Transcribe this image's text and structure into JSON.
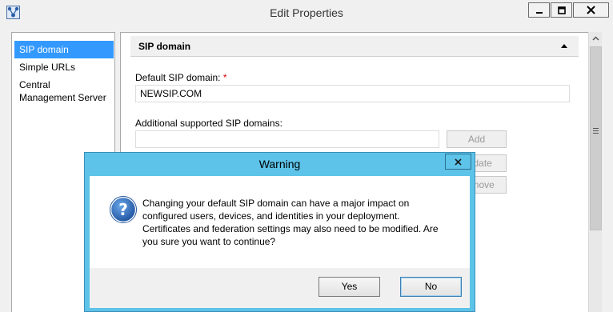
{
  "window": {
    "title": "Edit Properties",
    "icon": "topology-app-icon",
    "controls": {
      "minimize": "minimize-icon",
      "maximize": "maximize-icon",
      "close": "close-icon"
    }
  },
  "nav": {
    "items": [
      {
        "label": "SIP domain",
        "selected": true
      },
      {
        "label": "Simple URLs",
        "selected": false
      },
      {
        "label": "Central Management Server",
        "selected": false
      }
    ]
  },
  "section": {
    "title": "SIP domain",
    "default_label": "Default SIP domain:",
    "required_marker": "*",
    "default_value": "NEWSIP.COM",
    "additional_label": "Additional supported SIP domains:",
    "additional_value": "",
    "buttons": {
      "add": "Add",
      "update": "Update",
      "remove": "Remove"
    }
  },
  "dialog": {
    "title": "Warning",
    "icon": "question-icon",
    "message_lines": [
      "Changing your default SIP domain can have a major impact on",
      "configured users, devices, and identities in your deployment.",
      "Certificates and federation settings may also need to be modified. Are",
      "you sure you want to continue?"
    ],
    "yes_label": "Yes",
    "no_label": "No"
  },
  "colors": {
    "selection": "#3399ff",
    "dialog_frame": "#5dc3e8",
    "required": "#e00000"
  }
}
